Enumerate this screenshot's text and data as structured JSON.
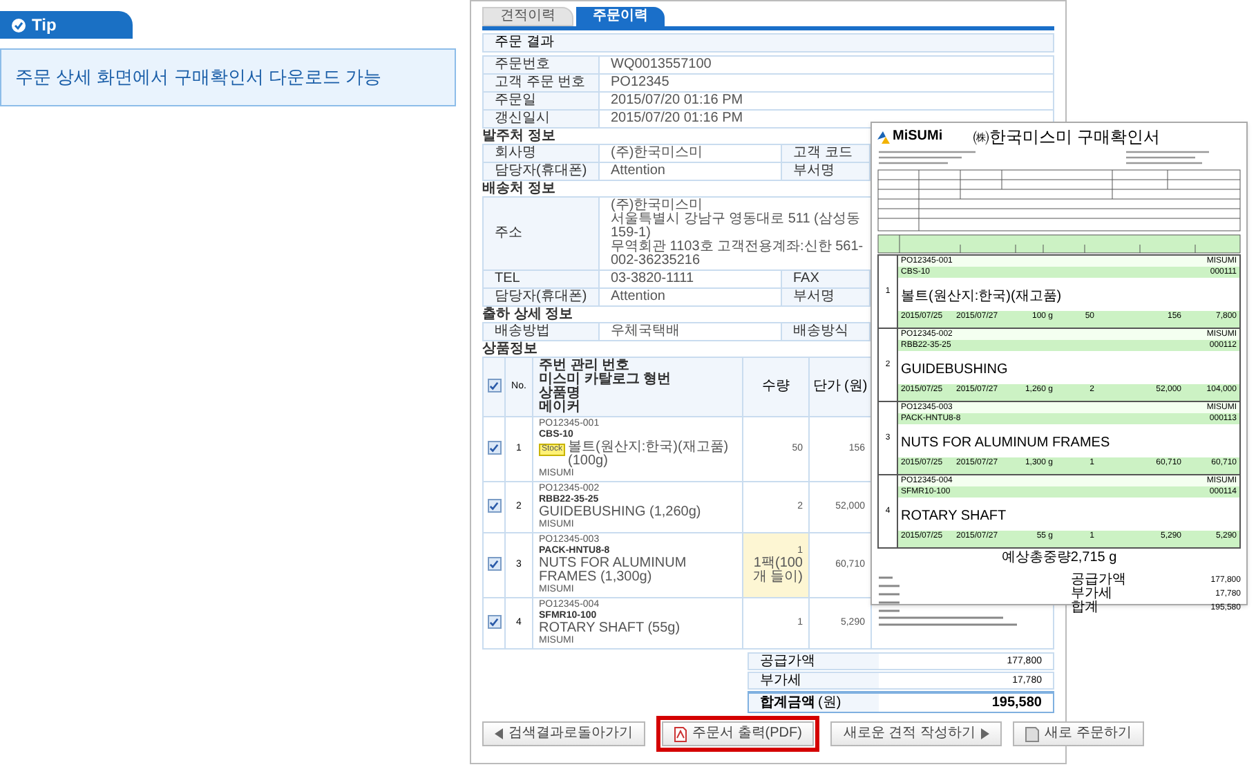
{
  "tip": {
    "badge": "Tip",
    "text": "주문 상세 화면에서 구매확인서 다운로드 가능"
  },
  "tabs": [
    {
      "label": "견적이력",
      "selected": false
    },
    {
      "label": "주문이력",
      "selected": true
    }
  ],
  "result_title": "주문 결과",
  "order_info": [
    {
      "label": "주문번호",
      "value": "WQ0013557100"
    },
    {
      "label": "고객 주문 번호",
      "value": "PO12345"
    },
    {
      "label": "주문일",
      "value": "2015/07/20 01:16 PM"
    },
    {
      "label": "갱신일시",
      "value": "2015/07/20 01:16 PM"
    }
  ],
  "sections": [
    {
      "title": "발주처 정보",
      "rows": [
        {
          "label": "회사명",
          "value": "(주)한국미스미",
          "label_2": "고객 코드"
        },
        {
          "label": "담당자(휴대폰)",
          "value": "Attention",
          "label_2": "부서명"
        }
      ]
    },
    {
      "title": "배송처 정보",
      "rows": [
        {
          "label": "주소",
          "lines": [
            "(주)한국미스미",
            "서울특별시 강남구 영동대로 511 (삼성동159-1)",
            "무역회관 1103호 고객전용계좌:신한 561-002-36235216"
          ]
        },
        {
          "label": "TEL",
          "value": "03-3820-1111",
          "label_2": "FAX"
        },
        {
          "label": "담당자(휴대폰)",
          "value": "Attention",
          "label_2": "부서명"
        }
      ]
    },
    {
      "title": "출하 상세 정보",
      "rows": [
        {
          "label": "배송방법",
          "value": "우체국택배",
          "label_2": "배송방식"
        }
      ]
    }
  ],
  "products": {
    "title": "상품정보",
    "all_checked": true,
    "columns": {
      "no": "No.",
      "item": [
        "주번 관리 번호",
        "미스미 카탈로그 형번",
        "상품명",
        "메이커"
      ],
      "qty": "수량",
      "price": "단가 (원)"
    },
    "rows": [
      {
        "checked": true,
        "no": "1",
        "po": "PO12345-001",
        "part": "CBS-10",
        "badge": "Stock",
        "name": "볼트(원산지:한국)(재고품) (100g)",
        "maker": "MISUMI",
        "qty": "50",
        "price": "156",
        "highlight": false
      },
      {
        "checked": true,
        "no": "2",
        "po": "PO12345-002",
        "part": "RBB22-35-25",
        "name": "GUIDEBUSHING (1,260g)",
        "maker": "MISUMI",
        "qty": "2",
        "price": "52,000",
        "highlight": false
      },
      {
        "checked": true,
        "no": "3",
        "po": "PO12345-003",
        "part": "PACK-HNTU8-8",
        "name": "NUTS FOR ALUMINUM FRAMES (1,300g)",
        "maker": "MISUMI",
        "qty": "1",
        "qty_note": "1팩(100개 들이)",
        "price": "60,710",
        "highlight": true
      },
      {
        "checked": true,
        "no": "4",
        "po": "PO12345-004",
        "part": "SFMR10-100",
        "name": "ROTARY SHAFT (55g)",
        "maker": "MISUMI",
        "qty": "1",
        "price": "5,290",
        "highlight": false
      }
    ]
  },
  "summary": [
    {
      "label": "공급가액",
      "value": "177,800",
      "emphasis": false
    },
    {
      "label": "부가세",
      "value": "17,780",
      "emphasis": false
    },
    {
      "label": "합계금액",
      "unit": "(원)",
      "value": "195,580",
      "emphasis": true
    }
  ],
  "buttons": [
    {
      "kind": "back",
      "label": "검색결과로돌아가기",
      "highlighted": false
    },
    {
      "kind": "pdf",
      "label": "주문서 출력(PDF)",
      "highlighted": true
    },
    {
      "kind": "next",
      "label": "새로운 견적 작성하기",
      "highlighted": false
    },
    {
      "kind": "order",
      "label": "새로 주문하기",
      "highlighted": false
    }
  ],
  "document": {
    "logo": "MiSUMi",
    "title": "㈱한국미스미 구매확인서",
    "items": [
      {
        "no": "1",
        "po": "PO12345-001",
        "maker": "MISUMI",
        "part": "CBS-10",
        "code": "000111",
        "name": "볼트(원산지:한국)(재고품)",
        "ship": "2015/07/25",
        "due": "2015/07/27",
        "weight": "100 g",
        "qty": "50",
        "price": "156",
        "total": "7,800"
      },
      {
        "no": "2",
        "po": "PO12345-002",
        "maker": "MISUMI",
        "part": "RBB22-35-25",
        "code": "000112",
        "name": "GUIDEBUSHING",
        "ship": "2015/07/25",
        "due": "2015/07/27",
        "weight": "1,260 g",
        "qty": "2",
        "price": "52,000",
        "total": "104,000"
      },
      {
        "no": "3",
        "po": "PO12345-003",
        "maker": "MISUMI",
        "part": "PACK-HNTU8-8",
        "code": "000113",
        "name": "NUTS FOR ALUMINUM FRAMES",
        "ship": "2015/07/25",
        "due": "2015/07/27",
        "weight": "1,300 g",
        "qty": "1",
        "price": "60,710",
        "total": "60,710"
      },
      {
        "no": "4",
        "po": "PO12345-004",
        "maker": "MISUMI",
        "part": "SFMR10-100",
        "code": "000114",
        "name": "ROTARY SHAFT",
        "ship": "2015/07/25",
        "due": "2015/07/27",
        "weight": "55 g",
        "qty": "1",
        "price": "5,290",
        "total": "5,290"
      }
    ],
    "weight_total": "예상총중량2,715 g",
    "totals": [
      {
        "label": "공급가액",
        "value": "177,800"
      },
      {
        "label": "부가세",
        "value": "17,780"
      },
      {
        "label": "합계",
        "value": "195,580"
      }
    ]
  }
}
